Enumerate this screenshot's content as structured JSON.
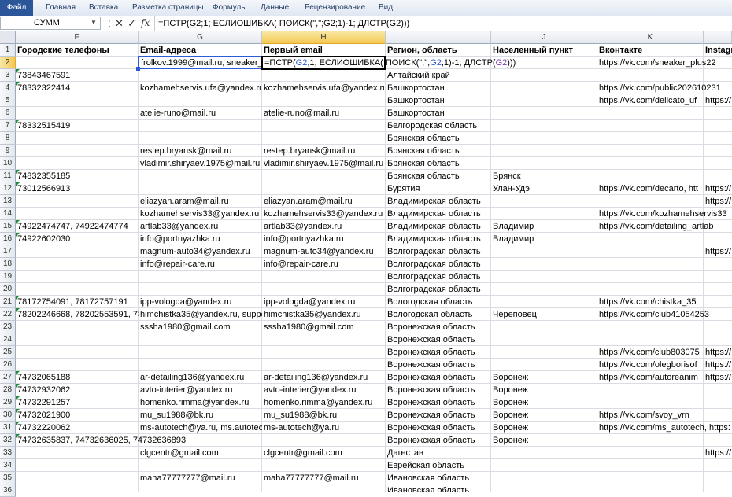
{
  "ribbon": {
    "tabs": [
      "Файл",
      "Главная",
      "Вставка",
      "Разметка страницы",
      "Формулы",
      "Данные",
      "Рецензирование",
      "Вид"
    ]
  },
  "formula_bar": {
    "name_box": "СУММ",
    "formula": "=ПСТР(G2;1; ЕСЛИОШИБКА( ПОИСК(\",\";G2;1)-1; ДЛСТР(G2)))",
    "cancel_icon": "x-icon",
    "enter_icon": "check-icon",
    "fx_label": "fx"
  },
  "columns": [
    "F",
    "G",
    "H",
    "I",
    "J",
    "K"
  ],
  "active_column": "H",
  "active_row": "2",
  "rows": [
    "1",
    "2",
    "3",
    "4",
    "5",
    "6",
    "7",
    "8",
    "9",
    "10",
    "11",
    "12",
    "13",
    "14",
    "15",
    "16",
    "17",
    "18",
    "19",
    "20",
    "21",
    "22",
    "23",
    "24",
    "25",
    "26",
    "27",
    "28",
    "29",
    "30",
    "31",
    "32",
    "33",
    "34",
    "35",
    "36"
  ],
  "header_row": {
    "F": "Городские телефоны",
    "G": "Email-адреса",
    "H": "Первый email",
    "I": "Регион, область",
    "J": "Населенный пункт",
    "K": "Вконтакте",
    "L": "Instagr"
  },
  "edit_cell": {
    "G2": "frolkov.1999@mail.ru, sneaker_",
    "formula_parts": [
      "=ПСТР(",
      "G2",
      ";1; ЕСЛИОШИБКА( ПОИСК(\",\";",
      "G2",
      ";1)-1; ДЛСТР(",
      "G2",
      ")))"
    ],
    "K2": "https://vk.com/sneaker_plus22"
  },
  "table": [
    {
      "F": "73843467591",
      "G": "",
      "H": "",
      "I": "Алтайский край",
      "J": "",
      "K": "",
      "L": "",
      "tri": true
    },
    {
      "F": "78332322414",
      "G": "kozhamehservis.ufa@yandex.ru",
      "H": "kozhamehservis.ufa@yandex.ru",
      "I": "Башкортостан",
      "J": "",
      "K": "https://vk.com/public202610231",
      "L": "",
      "tri": true
    },
    {
      "F": "",
      "G": "",
      "H": "",
      "I": "Башкортостан",
      "J": "",
      "K": "https://vk.com/delicato_uf",
      "L": "https://",
      "tri": false
    },
    {
      "F": "",
      "G": "atelie-runo@mail.ru",
      "H": "atelie-runo@mail.ru",
      "I": "Башкортостан",
      "J": "",
      "K": "",
      "L": "",
      "tri": false
    },
    {
      "F": "78332515419",
      "G": "",
      "H": "",
      "I": "Белгородская область",
      "J": "",
      "K": "",
      "L": "",
      "tri": true
    },
    {
      "F": "",
      "G": "",
      "H": "",
      "I": "Брянская область",
      "J": "",
      "K": "",
      "L": "",
      "tri": false
    },
    {
      "F": "",
      "G": "restep.bryansk@mail.ru",
      "H": "restep.bryansk@mail.ru",
      "I": "Брянская область",
      "J": "",
      "K": "",
      "L": "",
      "tri": false
    },
    {
      "F": "",
      "G": "vladimir.shiryaev.1975@mail.ru",
      "H": "vladimir.shiryaev.1975@mail.ru",
      "I": "Брянская область",
      "J": "",
      "K": "",
      "L": "",
      "tri": false
    },
    {
      "F": "74832355185",
      "G": "",
      "H": "",
      "I": "Брянская область",
      "J": "Брянск",
      "K": "",
      "L": "",
      "tri": true
    },
    {
      "F": "73012566913",
      "G": "",
      "H": "",
      "I": "Бурятия",
      "J": "Улан-Удэ",
      "K": "https://vk.com/decarto, htt",
      "L": "https://",
      "tri": true
    },
    {
      "F": "",
      "G": "eliazyan.aram@mail.ru",
      "H": "eliazyan.aram@mail.ru",
      "I": "Владимирская область",
      "J": "",
      "K": "",
      "L": "https://",
      "tri": false
    },
    {
      "F": "",
      "G": "kozhamehservis33@yandex.ru",
      "H": "kozhamehservis33@yandex.ru",
      "I": "Владимирская область",
      "J": "",
      "K": "https://vk.com/kozhamehservis33",
      "L": "",
      "tri": false
    },
    {
      "F": "74922474747, 74922474774",
      "G": "artlab33@yandex.ru",
      "H": "artlab33@yandex.ru",
      "I": "Владимирская область",
      "J": "Владимир",
      "K": "https://vk.com/detailing_artlab",
      "L": "",
      "tri": true
    },
    {
      "F": "74922602030",
      "G": "info@portnyazhka.ru",
      "H": "info@portnyazhka.ru",
      "I": "Владимирская область",
      "J": "Владимир",
      "K": "",
      "L": "",
      "tri": true
    },
    {
      "F": "",
      "G": "magnum-auto34@yandex.ru",
      "H": "magnum-auto34@yandex.ru",
      "I": "Волгоградская область",
      "J": "",
      "K": "",
      "L": "https://",
      "tri": false
    },
    {
      "F": "",
      "G": "info@repair-care.ru",
      "H": "info@repair-care.ru",
      "I": "Волгоградская область",
      "J": "",
      "K": "",
      "L": "",
      "tri": false
    },
    {
      "F": "",
      "G": "",
      "H": "",
      "I": "Волгоградская область",
      "J": "",
      "K": "",
      "L": "",
      "tri": false
    },
    {
      "F": "",
      "G": "",
      "H": "",
      "I": "Волгоградская область",
      "J": "",
      "K": "",
      "L": "",
      "tri": false
    },
    {
      "F": "78172754091, 78172757191",
      "G": "ipp-vologda@yandex.ru",
      "H": "ipp-vologda@yandex.ru",
      "I": "Вологодская область",
      "J": "",
      "K": "https://vk.com/chistka_35",
      "L": "",
      "tri": true
    },
    {
      "F": "78202246668, 78202553591, 7820",
      "G": "himchistka35@yandex.ru, suppo",
      "H": "himchistka35@yandex.ru",
      "I": "Вологодская область",
      "J": "Череповец",
      "K": "https://vk.com/club41054253",
      "L": "",
      "tri": true
    },
    {
      "F": "",
      "G": "sssha1980@gmail.com",
      "H": "sssha1980@gmail.com",
      "I": "Воронежская область",
      "J": "",
      "K": "",
      "L": "",
      "tri": false
    },
    {
      "F": "",
      "G": "",
      "H": "",
      "I": "Воронежская область",
      "J": "",
      "K": "",
      "L": "",
      "tri": false
    },
    {
      "F": "",
      "G": "",
      "H": "",
      "I": "Воронежская область",
      "J": "",
      "K": "https://vk.com/club803075",
      "L": "https://",
      "tri": false
    },
    {
      "F": "",
      "G": "",
      "H": "",
      "I": "Воронежская область",
      "J": "",
      "K": "https://vk.com/olegborisof",
      "L": "https://",
      "tri": false
    },
    {
      "F": "74732065188",
      "G": "ar-detailing136@yandex.ru",
      "H": "ar-detailing136@yandex.ru",
      "I": "Воронежская область",
      "J": "Воронеж",
      "K": "https://vk.com/autoreanim",
      "L": "https://",
      "tri": true
    },
    {
      "F": "74732932062",
      "G": "avto-interier@yandex.ru",
      "H": "avto-interier@yandex.ru",
      "I": "Воронежская область",
      "J": "Воронеж",
      "K": "",
      "L": "",
      "tri": true
    },
    {
      "F": "74732291257",
      "G": "homenko.rimma@yandex.ru",
      "H": "homenko.rimma@yandex.ru",
      "I": "Воронежская область",
      "J": "Воронеж",
      "K": "",
      "L": "",
      "tri": true
    },
    {
      "F": "74732021900",
      "G": "mu_su1988@bk.ru",
      "H": "mu_su1988@bk.ru",
      "I": "Воронежская область",
      "J": "Воронеж",
      "K": "https://vk.com/svoy_vrn",
      "L": "",
      "tri": true
    },
    {
      "F": "74732220062",
      "G": "ms-autotech@ya.ru, ms.autotec",
      "H": "ms-autotech@ya.ru",
      "I": "Воронежская область",
      "J": "Воронеж",
      "K": "https://vk.com/ms_autotech, https:",
      "L": "",
      "tri": true
    },
    {
      "F": "74732635837, 74732636025, 74732636893",
      "G": "",
      "H": "",
      "I": "Воронежская область",
      "J": "Воронеж",
      "K": "",
      "L": "",
      "tri": true
    },
    {
      "F": "",
      "G": "clgcentr@gmail.com",
      "H": "clgcentr@gmail.com",
      "I": "Дагестан",
      "J": "",
      "K": "",
      "L": "https://",
      "tri": false
    },
    {
      "F": "",
      "G": "",
      "H": "",
      "I": "Еврейская область",
      "J": "",
      "K": "",
      "L": "",
      "tri": false
    },
    {
      "F": "",
      "G": "maha77777777@mail.ru",
      "H": "maha77777777@mail.ru",
      "I": "Ивановская область",
      "J": "",
      "K": "",
      "L": "",
      "tri": false
    },
    {
      "F": "",
      "G": "",
      "H": "",
      "I": "Ивановская область",
      "J": "",
      "K": "",
      "L": "",
      "tri": false
    }
  ]
}
